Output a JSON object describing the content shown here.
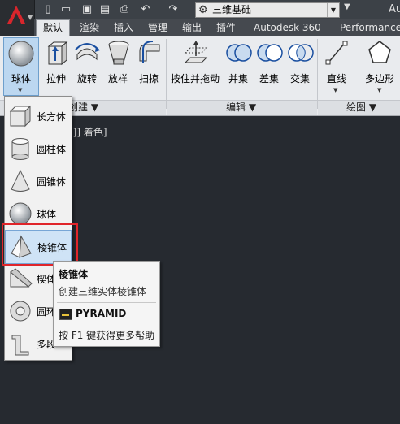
{
  "titlebar": {
    "workspace": "三维基础",
    "title_partial": "Au",
    "quick_access": [
      "new-icon",
      "open-icon",
      "save-icon",
      "saveas-icon",
      "print-icon",
      "undo-icon",
      "redo-icon"
    ]
  },
  "tabs": [
    "默认",
    "渲染",
    "插入",
    "管理",
    "输出",
    "插件",
    "Autodesk 360",
    "Performance"
  ],
  "ribbon": {
    "create_buttons": [
      "球体",
      "拉伸",
      "旋转",
      "放样",
      "扫掠"
    ],
    "edit_buttons": [
      "按住并拖动",
      "并集",
      "差集",
      "交集"
    ],
    "draw_buttons": [
      "直线",
      "多边形"
    ],
    "panels": [
      "创建",
      "编辑",
      "绘图"
    ]
  },
  "canvas": {
    "view_label": "]]] 着色]"
  },
  "dropdown": {
    "items": [
      "长方体",
      "圆柱体",
      "圆锥体",
      "球体",
      "棱锥体",
      "楔体",
      "圆环",
      "多段"
    ]
  },
  "tooltip": {
    "title": "棱锥体",
    "description": "创建三维实体棱锥体",
    "command": "PYRAMID",
    "help": "按 F1 键获得更多帮助"
  },
  "colors": {
    "highlight": "#e0252a",
    "hover": "#cfe3f6",
    "canvas": "#262a30"
  }
}
